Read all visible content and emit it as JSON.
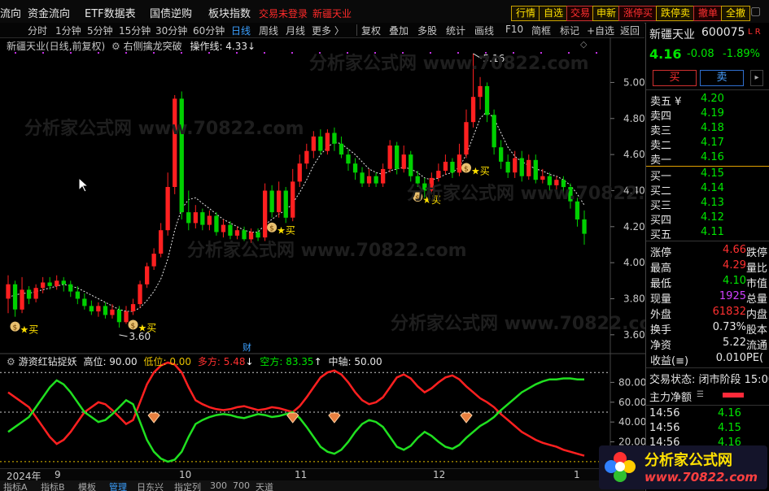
{
  "topmenu": {
    "items": [
      "流向",
      "资金流向",
      "ETF数据表",
      "国债逆购",
      "板块指数"
    ],
    "status_red": "交易未登录",
    "stock_red": "新疆天业",
    "right_buttons": [
      "行情",
      "自选",
      "交易",
      "申新",
      "涨停买",
      "跌停卖",
      "撤单",
      "全撤"
    ]
  },
  "period_bar": {
    "items": [
      "分时",
      "1分钟",
      "5分钟",
      "15分钟",
      "30分钟",
      "60分钟",
      "日线",
      "周线",
      "月线",
      "更多 〉"
    ],
    "selected": "日线",
    "tools": [
      "复权",
      "叠加",
      "多股",
      "统计",
      "画线",
      "F10",
      "简框",
      "标记",
      "+自选",
      "返回"
    ]
  },
  "chart_info": {
    "title": "新疆天业(日线,前复权)",
    "formula": "右侧擒龙突破",
    "operation_line": "操作线: 4.33↓"
  },
  "axis": {
    "price_ticks": [
      "5.00",
      "4.80",
      "4.60",
      "4.40",
      "4.20",
      "4.00",
      "3.80",
      "3.60"
    ],
    "ind_ticks": [
      "80.00",
      "60.00",
      "40.00",
      "20.00"
    ]
  },
  "annotations": {
    "high_label": "5.16",
    "low_label": "3.60",
    "buy_label": "★买",
    "finance_marker": "财"
  },
  "indicator": {
    "name": "游资红钻捉妖",
    "high": "高位: 90.00",
    "low": "低位: 0.00",
    "bull": "多方: 5.48",
    "bull_arrow": "↓",
    "bear": "空方: 83.35",
    "bear_arrow": "↑",
    "mid": "中轴: 50.00"
  },
  "date_axis": {
    "year": "2024年",
    "months": [
      "9",
      "10",
      "11",
      "12",
      "1"
    ]
  },
  "bottom_tabs": [
    "指标A",
    "指标B",
    "模板",
    "管理",
    "日东兴",
    "指定列",
    "300",
    "700",
    "天道"
  ],
  "quote": {
    "name": "新疆天业",
    "code": "600075",
    "flags": "L R",
    "price": "4.16",
    "change": "-0.08",
    "change_pct": "-1.89%",
    "buy_button": "买",
    "sell_button": "卖"
  },
  "orderbook": {
    "asks": [
      {
        "label": "卖五 ¥",
        "price": "4.20"
      },
      {
        "label": "卖四",
        "price": "4.19"
      },
      {
        "label": "卖三",
        "price": "4.18"
      },
      {
        "label": "卖二",
        "price": "4.17"
      },
      {
        "label": "卖一",
        "price": "4.16"
      }
    ],
    "bids": [
      {
        "label": "买一",
        "price": "4.15"
      },
      {
        "label": "买二",
        "price": "4.14"
      },
      {
        "label": "买三",
        "price": "4.13"
      },
      {
        "label": "买四",
        "price": "4.12"
      },
      {
        "label": "买五",
        "price": "4.11"
      }
    ]
  },
  "stats": [
    {
      "label": "涨停",
      "value": "4.66",
      "color": "#ff3030",
      "right": "跌停"
    },
    {
      "label": "最高",
      "value": "4.29",
      "color": "#ff3030",
      "right": "量比"
    },
    {
      "label": "最低",
      "value": "4.10",
      "color": "#00e600",
      "right": "市值"
    },
    {
      "label": "现量",
      "value": "1925",
      "color": "#d040ff",
      "right": "总量"
    },
    {
      "label": "外盘",
      "value": "61832",
      "color": "#ff3030",
      "right": "内盘"
    },
    {
      "label": "换手",
      "value": "0.73%",
      "color": "#e6e6e6",
      "right": "股本"
    },
    {
      "label": "净资",
      "value": "5.22",
      "color": "#e6e6e6",
      "right": "流通"
    },
    {
      "label": "收益(≡)",
      "value": "0.010",
      "color": "#e6e6e6",
      "right": "PE("
    }
  ],
  "trade_state": "交易状态: 闭市阶段 15:00",
  "main_flow": "主力净额",
  "ticks": [
    {
      "time": "14:56",
      "price": "4.16"
    },
    {
      "time": "14:56",
      "price": "4.15"
    },
    {
      "time": "14:56",
      "price": "4.16"
    }
  ],
  "logo": {
    "text": "分析家公式网",
    "url": "www.70822.com"
  },
  "watermark": "分析家公式网 www.70822.com",
  "colors": {
    "up": "#ff2020",
    "down": "#00d000",
    "accent": "#3ba0ff",
    "yellow": "#ffe000"
  },
  "chart_data": {
    "type": "candlestick",
    "y_range": [
      3.5,
      5.25
    ],
    "x_month_labels": [
      "9",
      "10",
      "11",
      "12",
      "1"
    ],
    "price_high": 5.16,
    "price_low": 3.6,
    "candles": [
      [
        3.8,
        3.88,
        3.93,
        3.72
      ],
      [
        3.88,
        3.74,
        3.9,
        3.7
      ],
      [
        3.74,
        3.85,
        3.92,
        3.72
      ],
      [
        3.85,
        3.8,
        3.87,
        3.77
      ],
      [
        3.8,
        3.86,
        3.88,
        3.78
      ],
      [
        3.86,
        3.89,
        3.92,
        3.83
      ],
      [
        3.89,
        3.87,
        3.92,
        3.85
      ],
      [
        3.87,
        3.9,
        3.93,
        3.85
      ],
      [
        3.9,
        3.88,
        3.92,
        3.84
      ],
      [
        3.88,
        3.84,
        3.9,
        3.81
      ],
      [
        3.84,
        3.8,
        3.87,
        3.77
      ],
      [
        3.8,
        3.76,
        3.83,
        3.74
      ],
      [
        3.76,
        3.73,
        3.79,
        3.71
      ],
      [
        3.73,
        3.76,
        3.78,
        3.7
      ],
      [
        3.76,
        3.71,
        3.78,
        3.69
      ],
      [
        3.71,
        3.74,
        3.77,
        3.69
      ],
      [
        3.74,
        3.67,
        3.76,
        3.64
      ],
      [
        3.67,
        3.73,
        3.76,
        3.66
      ],
      [
        3.73,
        3.77,
        3.8,
        3.71
      ],
      [
        3.77,
        3.88,
        3.9,
        3.75
      ],
      [
        3.88,
        3.98,
        4.0,
        3.86
      ],
      [
        3.98,
        4.05,
        4.08,
        3.96
      ],
      [
        4.05,
        4.18,
        4.22,
        4.03
      ],
      [
        4.18,
        4.42,
        4.5,
        4.15
      ],
      [
        4.42,
        4.91,
        4.93,
        4.38
      ],
      [
        4.91,
        4.28,
        4.95,
        4.24
      ],
      [
        4.28,
        4.22,
        4.4,
        4.18
      ],
      [
        4.22,
        4.28,
        4.32,
        4.19
      ],
      [
        4.28,
        4.21,
        4.3,
        4.18
      ],
      [
        4.21,
        4.26,
        4.29,
        4.18
      ],
      [
        4.26,
        4.17,
        4.28,
        4.15
      ],
      [
        4.17,
        4.21,
        4.24,
        4.14
      ],
      [
        4.21,
        4.15,
        4.23,
        4.13
      ],
      [
        4.15,
        4.18,
        4.2,
        4.13
      ],
      [
        4.18,
        4.13,
        4.2,
        4.12
      ],
      [
        4.13,
        4.17,
        4.19,
        4.11
      ],
      [
        4.17,
        4.14,
        4.19,
        4.12
      ],
      [
        4.14,
        4.4,
        4.44,
        4.12
      ],
      [
        4.4,
        4.28,
        4.43,
        4.25
      ],
      [
        4.28,
        4.4,
        4.45,
        4.25
      ],
      [
        4.4,
        4.25,
        4.42,
        4.22
      ],
      [
        4.25,
        4.45,
        4.52,
        4.23
      ],
      [
        4.45,
        4.55,
        4.6,
        4.42
      ],
      [
        4.55,
        4.62,
        4.66,
        4.52
      ],
      [
        4.62,
        4.7,
        4.73,
        4.58
      ],
      [
        4.7,
        4.62,
        4.74,
        4.6
      ],
      [
        4.62,
        4.72,
        4.74,
        4.6
      ],
      [
        4.72,
        4.66,
        4.75,
        4.62
      ],
      [
        4.66,
        4.6,
        4.7,
        4.58
      ],
      [
        4.6,
        4.55,
        4.63,
        4.51
      ],
      [
        4.55,
        4.5,
        4.58,
        4.46
      ],
      [
        4.5,
        4.44,
        4.53,
        4.42
      ],
      [
        4.44,
        4.48,
        4.52,
        4.42
      ],
      [
        4.48,
        4.44,
        4.5,
        4.42
      ],
      [
        4.44,
        4.52,
        4.55,
        4.42
      ],
      [
        4.52,
        4.65,
        4.68,
        4.5
      ],
      [
        4.65,
        4.52,
        4.67,
        4.49
      ],
      [
        4.52,
        4.6,
        4.65,
        4.5
      ],
      [
        4.6,
        4.48,
        4.62,
        4.45
      ],
      [
        4.48,
        4.44,
        4.51,
        4.42
      ],
      [
        4.44,
        4.4,
        4.47,
        4.36
      ],
      [
        4.4,
        4.47,
        4.5,
        4.38
      ],
      [
        4.47,
        4.51,
        4.55,
        4.45
      ],
      [
        4.51,
        4.56,
        4.6,
        4.49
      ],
      [
        4.56,
        4.5,
        4.58,
        4.47
      ],
      [
        4.5,
        4.6,
        4.66,
        4.48
      ],
      [
        4.6,
        4.78,
        4.85,
        4.58
      ],
      [
        4.78,
        4.92,
        5.16,
        4.75
      ],
      [
        4.92,
        4.98,
        5.03,
        4.85
      ],
      [
        4.98,
        4.82,
        5.0,
        4.78
      ],
      [
        4.82,
        4.64,
        4.85,
        4.6
      ],
      [
        4.64,
        4.56,
        4.68,
        4.52
      ],
      [
        4.56,
        4.5,
        4.6,
        4.47
      ],
      [
        4.5,
        4.58,
        4.62,
        4.47
      ],
      [
        4.58,
        4.48,
        4.62,
        4.45
      ],
      [
        4.48,
        4.57,
        4.6,
        4.46
      ],
      [
        4.57,
        4.46,
        4.6,
        4.44
      ],
      [
        4.46,
        4.48,
        4.52,
        4.44
      ],
      [
        4.48,
        4.43,
        4.5,
        4.4
      ],
      [
        4.43,
        4.46,
        4.48,
        4.4
      ],
      [
        4.46,
        4.42,
        4.48,
        4.38
      ],
      [
        4.42,
        4.34,
        4.44,
        4.3
      ],
      [
        4.34,
        4.24,
        4.36,
        4.2
      ],
      [
        4.24,
        4.16,
        4.29,
        4.1
      ]
    ],
    "ma_line": [
      3.81,
      3.82,
      3.83,
      3.83,
      3.84,
      3.85,
      3.86,
      3.87,
      3.88,
      3.87,
      3.86,
      3.84,
      3.82,
      3.8,
      3.78,
      3.76,
      3.74,
      3.73,
      3.73,
      3.75,
      3.79,
      3.84,
      3.91,
      4.02,
      4.18,
      4.3,
      4.35,
      4.36,
      4.33,
      4.3,
      4.27,
      4.24,
      4.22,
      4.2,
      4.18,
      4.17,
      4.17,
      4.21,
      4.24,
      4.27,
      4.29,
      4.33,
      4.39,
      4.46,
      4.54,
      4.6,
      4.64,
      4.67,
      4.66,
      4.63,
      4.6,
      4.56,
      4.52,
      4.5,
      4.49,
      4.51,
      4.52,
      4.53,
      4.52,
      4.5,
      4.47,
      4.46,
      4.47,
      4.49,
      4.5,
      4.53,
      4.6,
      4.7,
      4.8,
      4.84,
      4.8,
      4.72,
      4.64,
      4.59,
      4.56,
      4.54,
      4.52,
      4.51,
      4.49,
      4.48,
      4.46,
      4.43,
      4.38,
      4.32
    ],
    "buy_signals": [
      1,
      18,
      38,
      59,
      66
    ],
    "ind_range": [
      -5,
      100
    ],
    "ind_bull": [
      30,
      35,
      40,
      45,
      55,
      65,
      75,
      82,
      78,
      70,
      60,
      50,
      45,
      40,
      42,
      48,
      55,
      62,
      58,
      40,
      22,
      10,
      3,
      0,
      2,
      10,
      25,
      38,
      42,
      45,
      47,
      48,
      47,
      45,
      44,
      46,
      48,
      47,
      45,
      46,
      48,
      50,
      44,
      35,
      25,
      15,
      10,
      8,
      12,
      20,
      30,
      38,
      42,
      40,
      35,
      25,
      15,
      12,
      16,
      24,
      30,
      26,
      20,
      15,
      13,
      17,
      24,
      30,
      36,
      40,
      45,
      52,
      58,
      64,
      70,
      74,
      78,
      81,
      83,
      83,
      84,
      84,
      83,
      83
    ],
    "ind_bear": [
      70,
      65,
      60,
      55,
      45,
      35,
      25,
      18,
      22,
      30,
      40,
      50,
      55,
      60,
      58,
      52,
      45,
      38,
      42,
      60,
      78,
      90,
      97,
      100,
      98,
      90,
      75,
      62,
      58,
      55,
      53,
      52,
      53,
      55,
      56,
      54,
      52,
      53,
      55,
      54,
      52,
      50,
      56,
      65,
      75,
      85,
      90,
      92,
      88,
      80,
      70,
      62,
      58,
      60,
      65,
      75,
      85,
      88,
      84,
      76,
      70,
      74,
      80,
      85,
      87,
      83,
      76,
      70,
      64,
      60,
      55,
      48,
      42,
      36,
      30,
      26,
      22,
      19,
      17,
      15,
      12,
      10,
      8,
      6
    ],
    "ind_diamonds": [
      21,
      41,
      47,
      66
    ]
  }
}
